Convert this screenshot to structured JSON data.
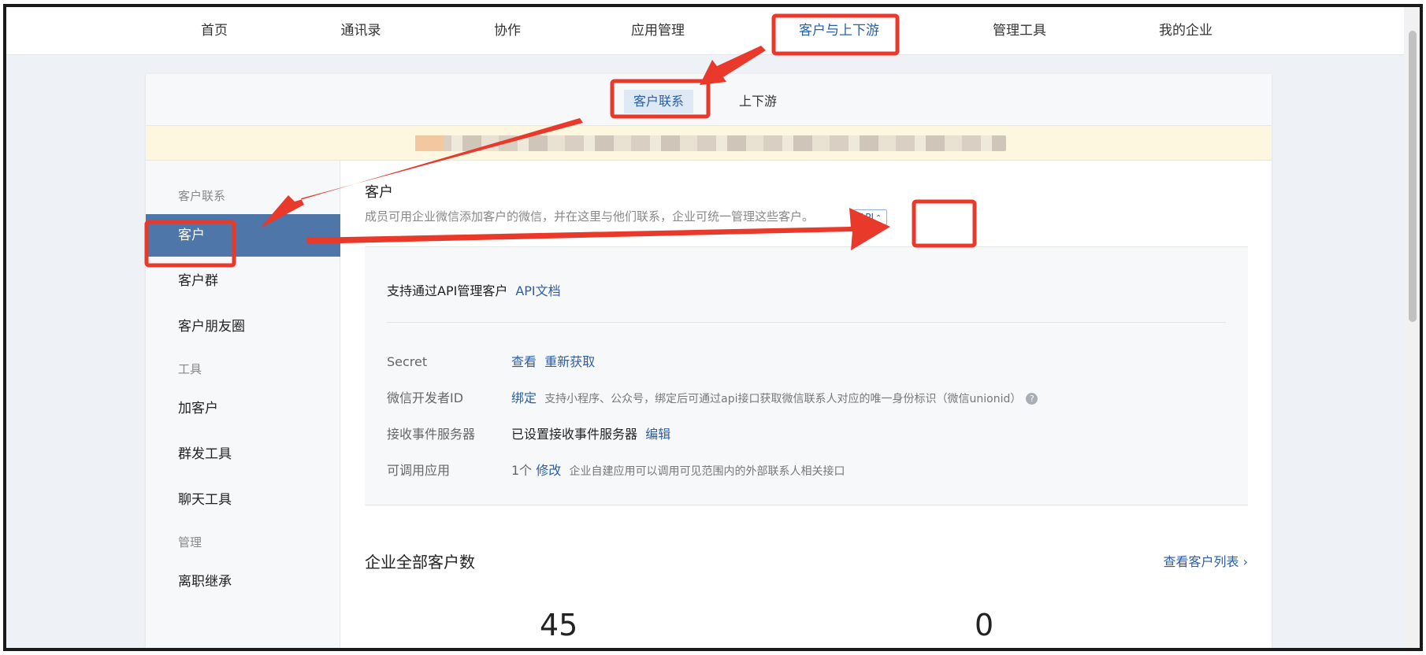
{
  "topnav": {
    "items": [
      {
        "label": "首页"
      },
      {
        "label": "通讯录"
      },
      {
        "label": "协作"
      },
      {
        "label": "应用管理"
      },
      {
        "label": "客户与上下游"
      },
      {
        "label": "管理工具"
      },
      {
        "label": "我的企业"
      }
    ],
    "active_index": 4
  },
  "subtabs": [
    {
      "label": "客户联系"
    },
    {
      "label": "上下游"
    }
  ],
  "sidebar": {
    "groups": [
      {
        "title": "客户联系",
        "items": [
          "客户",
          "客户群",
          "客户朋友圈"
        ]
      },
      {
        "title": "工具",
        "items": [
          "加客户",
          "群发工具",
          "聊天工具"
        ]
      },
      {
        "title": "管理",
        "items": [
          "离职继承"
        ]
      }
    ],
    "active_item": "客户"
  },
  "main": {
    "title": "客户",
    "description": "成员可用企业微信添加客户的微信，并在这里与他们联系，企业可统一管理这些客户。",
    "api_badge": "API",
    "api_panel": {
      "heading": "支持通过API管理客户",
      "doc_link": "API文档",
      "rows": [
        {
          "label": "Secret",
          "link1": "查看",
          "link2": "重新获取"
        },
        {
          "label": "微信开发者ID",
          "link": "绑定",
          "hint": "支持小程序、公众号，绑定后可通过api接口获取微信联系人对应的唯一身份标识（微信unionid）"
        },
        {
          "label": "接收事件服务器",
          "value": "已设置接收事件服务器",
          "link": "编辑"
        },
        {
          "label": "可调用应用",
          "value": "1个",
          "link": "修改",
          "hint": "企业自建应用可以调用可见范围内的外部联系人相关接口"
        }
      ]
    },
    "total": {
      "title": "企业全部客户数",
      "list_link": "查看客户列表 ›",
      "stats": [
        "45",
        "0"
      ]
    }
  },
  "colors": {
    "accent": "#2b5ea8",
    "sidebar_active": "#4e76a9",
    "annotation_red": "#e8392b"
  }
}
